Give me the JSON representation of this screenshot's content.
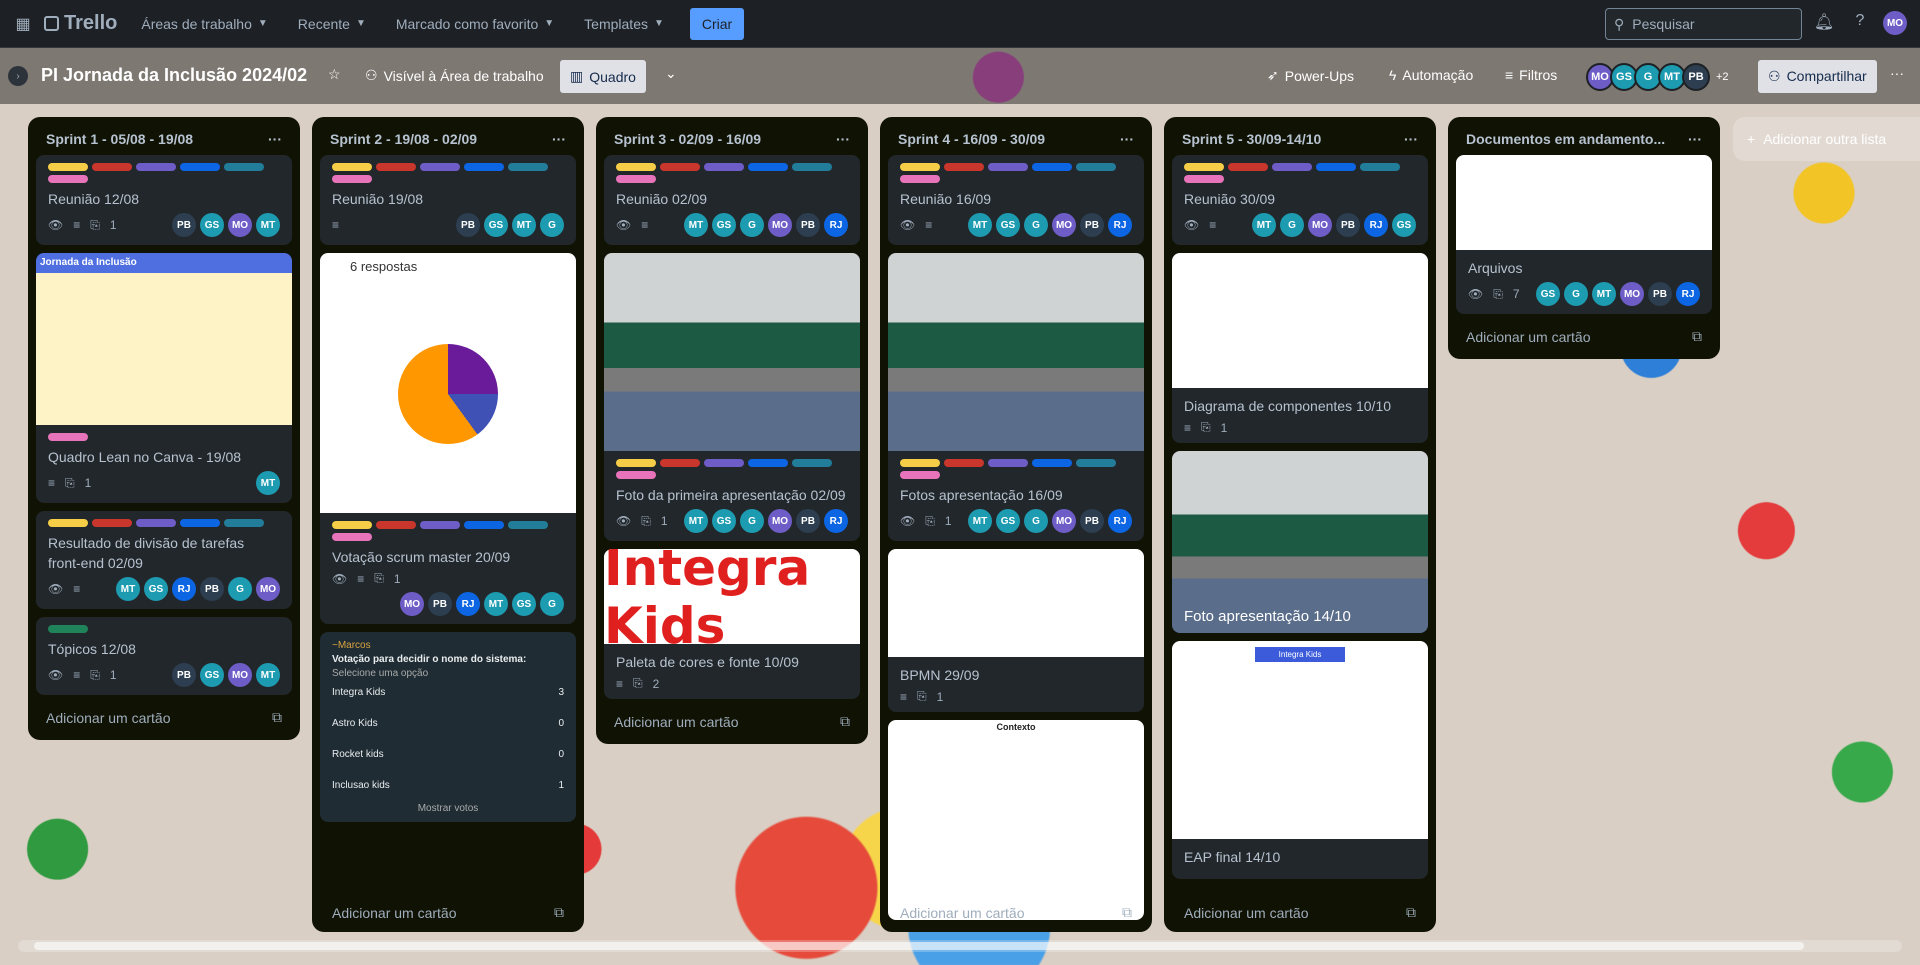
{
  "topbar": {
    "logo": "Trello",
    "menu": [
      "Áreas de trabalho",
      "Recente",
      "Marcado como favorito",
      "Templates"
    ],
    "create": "Criar",
    "search_placeholder": "Pesquisar",
    "user": "MO"
  },
  "board": {
    "title": "PI Jornada da Inclusão 2024/02",
    "visibility": "Visível à Área de trabalho",
    "view": "Quadro",
    "powerups": "Power-Ups",
    "automation": "Automação",
    "filters": "Filtros",
    "members": [
      "MO",
      "GS",
      "G",
      "MT",
      "PB"
    ],
    "more_members": "+2",
    "share": "Compartilhar"
  },
  "colors": {
    "MO": "#6e5dc6",
    "GS": "#1d9bb0",
    "G": "#1d9bb0",
    "MT": "#1d9bb0",
    "PB": "#2c3e50",
    "RJ": "#0c66e4"
  },
  "add_card": "Adicionar um cartão",
  "add_list": "Adicionar outra lista",
  "lists": [
    {
      "title": "Sprint 1 - 05/08 - 19/08",
      "cards": [
        {
          "title": "Reunião 12/08",
          "attach": "1",
          "members": [
            "PB",
            "GS",
            "MO",
            "MT"
          ]
        },
        {
          "title": "Quadro Lean no Canva - 19/08",
          "attach": "1",
          "members": [
            "MT"
          ],
          "cover": "Jornada da Inclusão"
        },
        {
          "title": "Resultado de divisão de tarefas front-end 02/09",
          "members": [
            "MT",
            "GS",
            "RJ",
            "PB",
            "G",
            "MO"
          ]
        },
        {
          "title": "Tópicos 12/08",
          "attach": "1",
          "members": [
            "PB",
            "GS",
            "MO",
            "MT"
          ]
        }
      ]
    },
    {
      "title": "Sprint 2 - 19/08 - 02/09",
      "cards": [
        {
          "title": "Reunião 19/08",
          "members": [
            "PB",
            "GS",
            "MT",
            "G"
          ]
        },
        {
          "title": "Votação scrum master 20/09",
          "attach": "1",
          "members": [
            "MO",
            "PB",
            "RJ",
            "MT",
            "GS",
            "G"
          ],
          "cover": "6 respostas"
        },
        {
          "title": "Votação para decidir o nome do sistema:",
          "author": "~Marcos",
          "options": [
            "Integra Kids",
            "Astro Kids",
            "Rocket kids",
            "Inclusao kids"
          ],
          "votes": [
            "3",
            "0",
            "0",
            "1"
          ],
          "select": "Selecione uma opção",
          "show": "Mostrar votos"
        }
      ]
    },
    {
      "title": "Sprint 3 - 02/09 - 16/09",
      "cards": [
        {
          "title": "Reunião 02/09",
          "members": [
            "MT",
            "GS",
            "G",
            "MO",
            "PB",
            "RJ"
          ]
        },
        {
          "title": "Foto da primeira apresentação 02/09",
          "attach": "1",
          "members": [
            "MT",
            "GS",
            "G",
            "MO",
            "PB",
            "RJ"
          ]
        },
        {
          "title": "Paleta de cores e fonte 10/09",
          "attach": "2",
          "cover": "Integra Kids"
        }
      ]
    },
    {
      "title": "Sprint 4 - 16/09 - 30/09",
      "cards": [
        {
          "title": "Reunião 16/09",
          "members": [
            "MT",
            "GS",
            "G",
            "MO",
            "PB",
            "RJ"
          ]
        },
        {
          "title": "Fotos apresentação 16/09",
          "attach": "1",
          "members": [
            "MT",
            "GS",
            "G",
            "MO",
            "PB",
            "RJ"
          ]
        },
        {
          "title": "BPMN 29/09",
          "attach": "1"
        },
        {
          "title": "",
          "cover": "Contexto"
        }
      ]
    },
    {
      "title": "Sprint 5 - 30/09-14/10",
      "cards": [
        {
          "title": "Reunião 30/09",
          "members": [
            "MT",
            "G",
            "MO",
            "PB",
            "RJ",
            "GS"
          ]
        },
        {
          "title": "Diagrama de componentes 10/10",
          "attach": "1"
        },
        {
          "title": "Foto apresentação 14/10"
        },
        {
          "title": "EAP final 14/10",
          "cover": "Integra Kids"
        }
      ]
    },
    {
      "title": "Documentos em andamento...",
      "cards": [
        {
          "title": "Arquivos",
          "attach": "7",
          "members": [
            "GS",
            "G",
            "MT",
            "MO",
            "PB",
            "RJ"
          ]
        }
      ]
    }
  ]
}
